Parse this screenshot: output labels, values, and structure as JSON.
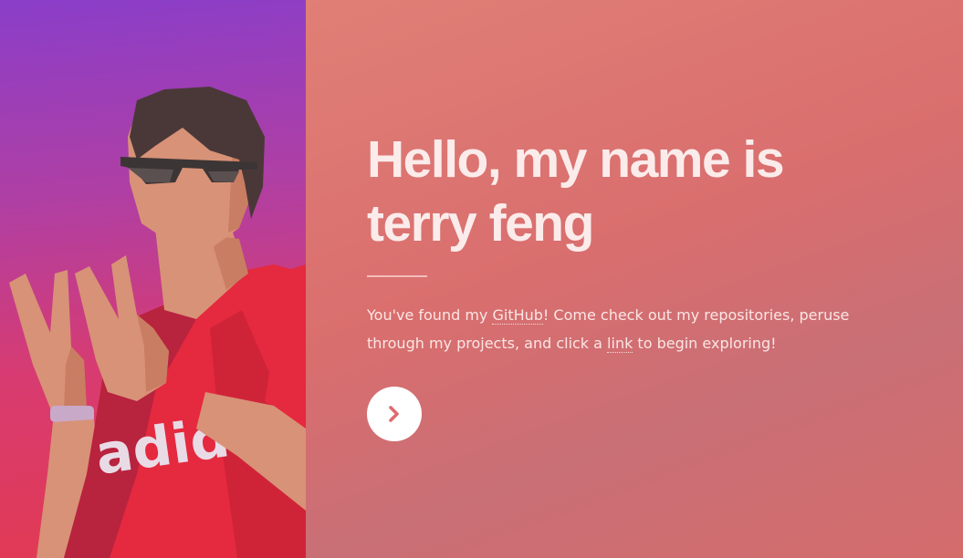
{
  "hero": {
    "headline_line1": "Hello, my name is",
    "headline_line2": "terry feng",
    "intro": {
      "part1": "You've found my ",
      "github_link": "GitHub",
      "part2": "! Come check out my repositories, peruse through my projects, and click a ",
      "link_text": "link",
      "part3": " to begin exploring!"
    },
    "next_button_icon": "chevron-right-icon"
  },
  "colors": {
    "left_gradient_top": "#8a3ec9",
    "left_gradient_bottom": "#e23a52",
    "right_background": "#d9706f",
    "headline_text": "#fbeceb",
    "button_background": "#ffffff",
    "button_icon": "#e06a6f"
  },
  "portrait": {
    "shirt_text": "adidas"
  }
}
